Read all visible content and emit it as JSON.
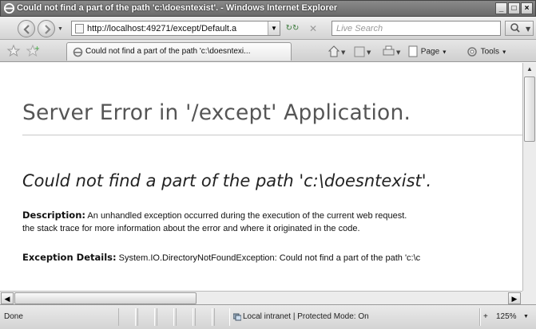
{
  "window": {
    "title": "Could not find a part of the path 'c:\\doesntexist'. - Windows Internet Explorer",
    "minimize": "_",
    "maximize": "□",
    "close": "×"
  },
  "nav": {
    "url": "http://localhost:49271/except/Default.a",
    "search_placeholder": "Live Search"
  },
  "tab": {
    "label": "Could not find a part of the path 'c:\\doesntexi..."
  },
  "toolbar": {
    "page_label": "Page",
    "tools_label": "Tools"
  },
  "page": {
    "heading": "Server Error in '/except' Application.",
    "error_title": "Could not find a part of the path 'c:\\doesntexist'.",
    "description_label": "Description:",
    "description_line1": " An unhandled exception occurred during the execution of the current web request.",
    "description_line2": "the stack trace for more information about the error and where it originated in the code.",
    "exception_label": "Exception Details:",
    "exception_text": " System.IO.DirectoryNotFoundException: Could not find a part of the path 'c:\\c"
  },
  "status": {
    "text": "Done",
    "zone": "Local intranet | Protected Mode: On",
    "zoom": "125%"
  }
}
